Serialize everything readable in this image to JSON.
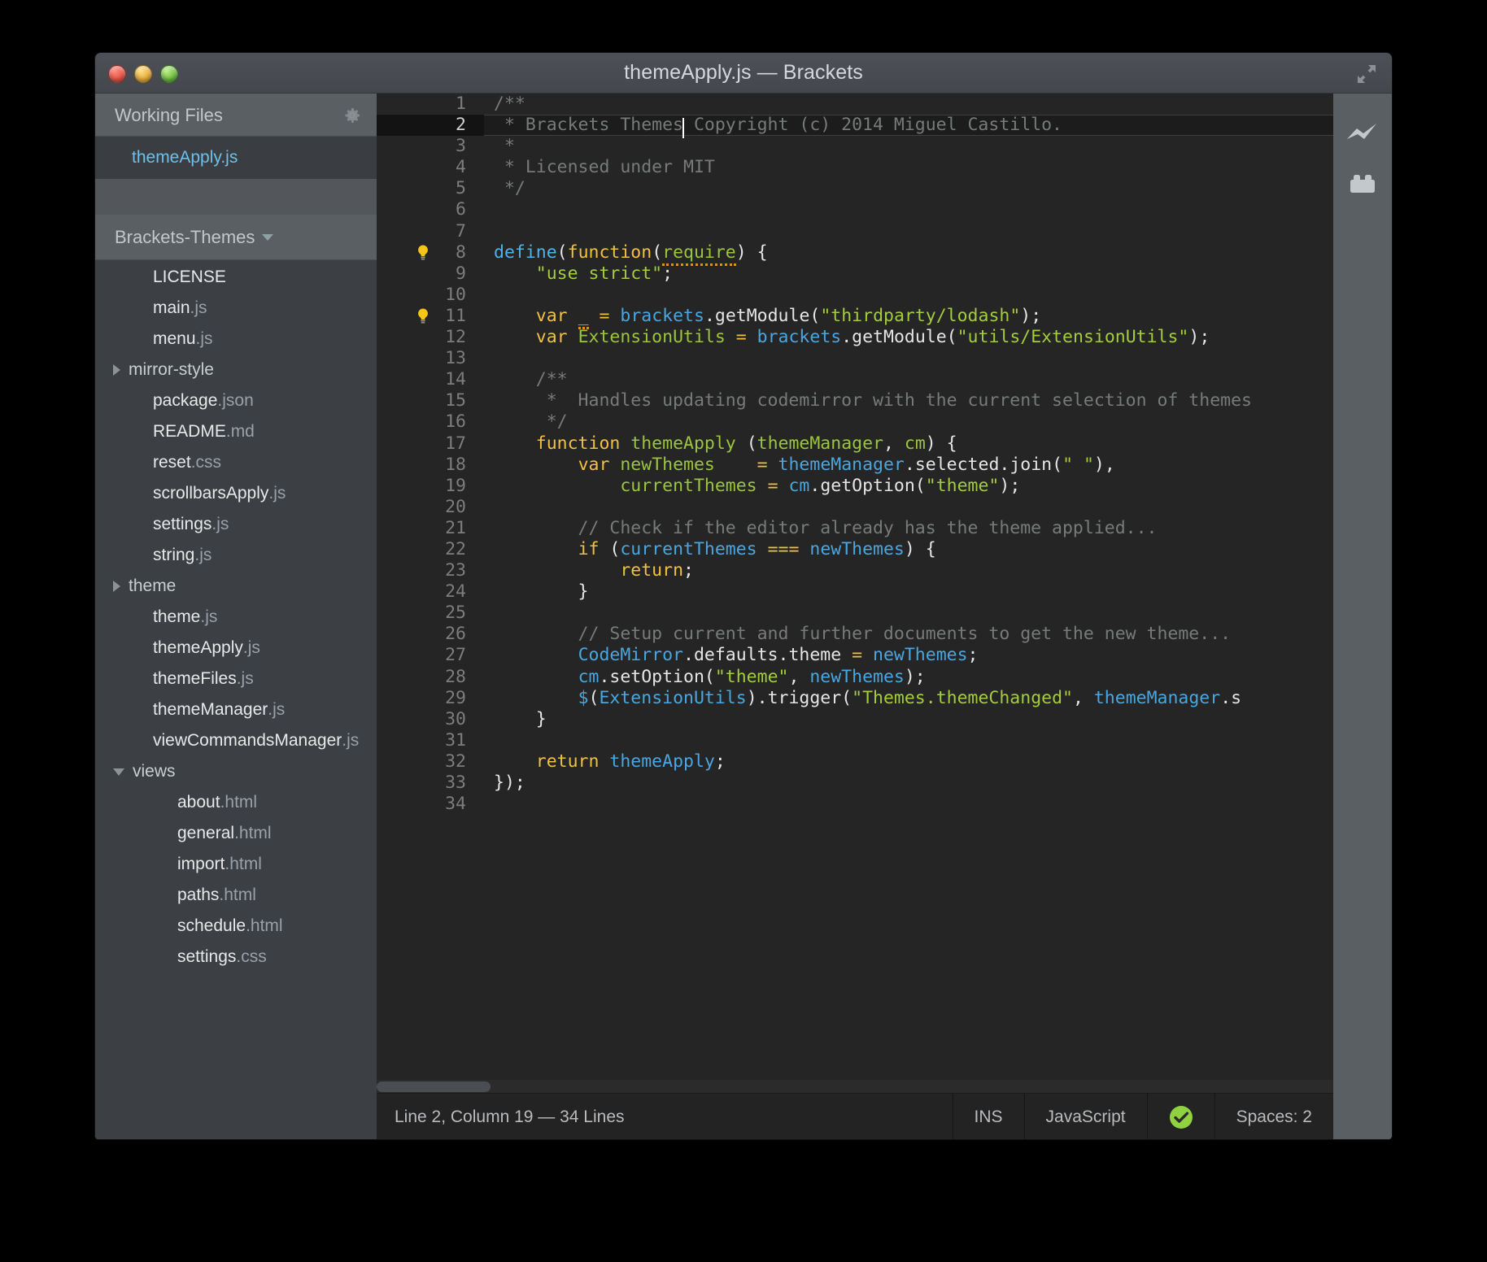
{
  "window": {
    "title": "themeApply.js — Brackets",
    "traffic_lights": [
      "close",
      "minimize",
      "zoom"
    ],
    "expand_icon": "expand-arrows-icon"
  },
  "sidebar": {
    "working_files": {
      "header_label": "Working Files",
      "gear_icon": "gear-icon",
      "items": [
        {
          "name": "themeApply",
          "ext": ".js",
          "selected": true
        }
      ]
    },
    "project": {
      "header_label": "Brackets-Themes",
      "caret_icon": "chevron-down-icon",
      "files": [
        {
          "name": "LICENSE",
          "ext": "",
          "type": "file",
          "indent": 1
        },
        {
          "name": "main",
          "ext": ".js",
          "type": "file",
          "indent": 1
        },
        {
          "name": "menu",
          "ext": ".js",
          "type": "file",
          "indent": 1
        },
        {
          "name": "mirror-style",
          "ext": "",
          "type": "folder",
          "indent": 0,
          "open": false
        },
        {
          "name": "package",
          "ext": ".json",
          "type": "file",
          "indent": 1
        },
        {
          "name": "README",
          "ext": ".md",
          "type": "file",
          "indent": 1
        },
        {
          "name": "reset",
          "ext": ".css",
          "type": "file",
          "indent": 1
        },
        {
          "name": "scrollbarsApply",
          "ext": ".js",
          "type": "file",
          "indent": 1
        },
        {
          "name": "settings",
          "ext": ".js",
          "type": "file",
          "indent": 1
        },
        {
          "name": "string",
          "ext": ".js",
          "type": "file",
          "indent": 1
        },
        {
          "name": "theme",
          "ext": "",
          "type": "folder",
          "indent": 0,
          "open": false
        },
        {
          "name": "theme",
          "ext": ".js",
          "type": "file",
          "indent": 1
        },
        {
          "name": "themeApply",
          "ext": ".js",
          "type": "file",
          "indent": 1
        },
        {
          "name": "themeFiles",
          "ext": ".js",
          "type": "file",
          "indent": 1
        },
        {
          "name": "themeManager",
          "ext": ".js",
          "type": "file",
          "indent": 1
        },
        {
          "name": "viewCommandsManager",
          "ext": ".js",
          "type": "file",
          "indent": 1
        },
        {
          "name": "views",
          "ext": "",
          "type": "folder",
          "indent": 0,
          "open": true
        },
        {
          "name": "about",
          "ext": ".html",
          "type": "file",
          "indent": 2
        },
        {
          "name": "general",
          "ext": ".html",
          "type": "file",
          "indent": 2
        },
        {
          "name": "import",
          "ext": ".html",
          "type": "file",
          "indent": 2
        },
        {
          "name": "paths",
          "ext": ".html",
          "type": "file",
          "indent": 2
        },
        {
          "name": "schedule",
          "ext": ".html",
          "type": "file",
          "indent": 2
        },
        {
          "name": "settings",
          "ext": ".css",
          "type": "file",
          "indent": 2
        }
      ]
    }
  },
  "editor": {
    "total_lines": 34,
    "active_line": 2,
    "cursor_column": 19,
    "lines": [
      {
        "n": 1,
        "bulb": false,
        "tokens": [
          {
            "t": "/**",
            "c": "c-com"
          }
        ]
      },
      {
        "n": 2,
        "bulb": false,
        "active": true,
        "tokens": [
          {
            "t": " * Brackets Themes",
            "c": "c-com"
          },
          {
            "t": "|CURSOR|",
            "c": "cursor"
          },
          {
            "t": " Copyright (c) 2014 Miguel Castillo.",
            "c": "c-com"
          }
        ]
      },
      {
        "n": 3,
        "bulb": false,
        "tokens": [
          {
            "t": " *",
            "c": "c-com"
          }
        ]
      },
      {
        "n": 4,
        "bulb": false,
        "tokens": [
          {
            "t": " * Licensed under MIT",
            "c": "c-com"
          }
        ]
      },
      {
        "n": 5,
        "bulb": false,
        "tokens": [
          {
            "t": " */",
            "c": "c-com"
          }
        ]
      },
      {
        "n": 6,
        "bulb": false,
        "tokens": []
      },
      {
        "n": 7,
        "bulb": false,
        "tokens": []
      },
      {
        "n": 8,
        "bulb": true,
        "tokens": [
          {
            "t": "define",
            "c": "c-def"
          },
          {
            "t": "(",
            "c": "c-punc"
          },
          {
            "t": "function",
            "c": "c-kw"
          },
          {
            "t": "(",
            "c": "c-punc"
          },
          {
            "t": "require",
            "c": "c-var squig"
          },
          {
            "t": ") {",
            "c": "c-punc"
          }
        ]
      },
      {
        "n": 9,
        "bulb": false,
        "tokens": [
          {
            "t": "    ",
            "c": "c-punc"
          },
          {
            "t": "\"use strict\"",
            "c": "c-str"
          },
          {
            "t": ";",
            "c": "c-punc"
          }
        ]
      },
      {
        "n": 10,
        "bulb": false,
        "tokens": []
      },
      {
        "n": 11,
        "bulb": true,
        "tokens": [
          {
            "t": "    ",
            "c": "c-punc"
          },
          {
            "t": "var",
            "c": "c-kw"
          },
          {
            "t": " ",
            "c": "c-punc"
          },
          {
            "t": "_",
            "c": "c-var squig"
          },
          {
            "t": " ",
            "c": "c-punc"
          },
          {
            "t": "=",
            "c": "c-kw"
          },
          {
            "t": " ",
            "c": "c-punc"
          },
          {
            "t": "brackets",
            "c": "c-atom"
          },
          {
            "t": ".getModule(",
            "c": "c-punc"
          },
          {
            "t": "\"thirdparty/lodash\"",
            "c": "c-str"
          },
          {
            "t": ");",
            "c": "c-punc"
          }
        ]
      },
      {
        "n": 12,
        "bulb": false,
        "tokens": [
          {
            "t": "    ",
            "c": "c-punc"
          },
          {
            "t": "var",
            "c": "c-kw"
          },
          {
            "t": " ",
            "c": "c-punc"
          },
          {
            "t": "ExtensionUtils",
            "c": "c-var"
          },
          {
            "t": " ",
            "c": "c-punc"
          },
          {
            "t": "=",
            "c": "c-kw"
          },
          {
            "t": " ",
            "c": "c-punc"
          },
          {
            "t": "brackets",
            "c": "c-atom"
          },
          {
            "t": ".getModule(",
            "c": "c-punc"
          },
          {
            "t": "\"utils/ExtensionUtils\"",
            "c": "c-str"
          },
          {
            "t": ");",
            "c": "c-punc"
          }
        ]
      },
      {
        "n": 13,
        "bulb": false,
        "tokens": []
      },
      {
        "n": 14,
        "bulb": false,
        "tokens": [
          {
            "t": "    /**",
            "c": "c-com"
          }
        ]
      },
      {
        "n": 15,
        "bulb": false,
        "tokens": [
          {
            "t": "     *  Handles updating codemirror with the current selection of themes",
            "c": "c-com"
          }
        ]
      },
      {
        "n": 16,
        "bulb": false,
        "tokens": [
          {
            "t": "     */",
            "c": "c-com"
          }
        ]
      },
      {
        "n": 17,
        "bulb": false,
        "tokens": [
          {
            "t": "    ",
            "c": "c-punc"
          },
          {
            "t": "function",
            "c": "c-kw"
          },
          {
            "t": " ",
            "c": "c-punc"
          },
          {
            "t": "themeApply",
            "c": "c-var"
          },
          {
            "t": " (",
            "c": "c-punc"
          },
          {
            "t": "themeManager",
            "c": "c-var"
          },
          {
            "t": ", ",
            "c": "c-punc"
          },
          {
            "t": "cm",
            "c": "c-var"
          },
          {
            "t": ") {",
            "c": "c-punc"
          }
        ]
      },
      {
        "n": 18,
        "bulb": false,
        "tokens": [
          {
            "t": "        ",
            "c": "c-punc"
          },
          {
            "t": "var",
            "c": "c-kw"
          },
          {
            "t": " ",
            "c": "c-punc"
          },
          {
            "t": "newThemes",
            "c": "c-var"
          },
          {
            "t": "    ",
            "c": "c-punc"
          },
          {
            "t": "=",
            "c": "c-kw"
          },
          {
            "t": " ",
            "c": "c-punc"
          },
          {
            "t": "themeManager",
            "c": "c-atom"
          },
          {
            "t": ".selected.join(",
            "c": "c-punc"
          },
          {
            "t": "\" \"",
            "c": "c-str"
          },
          {
            "t": "),",
            "c": "c-punc"
          }
        ]
      },
      {
        "n": 19,
        "bulb": false,
        "tokens": [
          {
            "t": "            ",
            "c": "c-punc"
          },
          {
            "t": "currentThemes",
            "c": "c-var"
          },
          {
            "t": " ",
            "c": "c-punc"
          },
          {
            "t": "=",
            "c": "c-kw"
          },
          {
            "t": " ",
            "c": "c-punc"
          },
          {
            "t": "cm",
            "c": "c-atom"
          },
          {
            "t": ".getOption(",
            "c": "c-punc"
          },
          {
            "t": "\"theme\"",
            "c": "c-str"
          },
          {
            "t": ");",
            "c": "c-punc"
          }
        ]
      },
      {
        "n": 20,
        "bulb": false,
        "tokens": []
      },
      {
        "n": 21,
        "bulb": false,
        "tokens": [
          {
            "t": "        // Check if the editor already has the theme applied...",
            "c": "c-com"
          }
        ]
      },
      {
        "n": 22,
        "bulb": false,
        "tokens": [
          {
            "t": "        ",
            "c": "c-punc"
          },
          {
            "t": "if",
            "c": "c-kw"
          },
          {
            "t": " (",
            "c": "c-punc"
          },
          {
            "t": "currentThemes",
            "c": "c-atom"
          },
          {
            "t": " ",
            "c": "c-punc"
          },
          {
            "t": "===",
            "c": "c-kw"
          },
          {
            "t": " ",
            "c": "c-punc"
          },
          {
            "t": "newThemes",
            "c": "c-atom"
          },
          {
            "t": ") {",
            "c": "c-punc"
          }
        ]
      },
      {
        "n": 23,
        "bulb": false,
        "tokens": [
          {
            "t": "            ",
            "c": "c-punc"
          },
          {
            "t": "return",
            "c": "c-kw"
          },
          {
            "t": ";",
            "c": "c-punc"
          }
        ]
      },
      {
        "n": 24,
        "bulb": false,
        "tokens": [
          {
            "t": "        }",
            "c": "c-punc"
          }
        ]
      },
      {
        "n": 25,
        "bulb": false,
        "tokens": []
      },
      {
        "n": 26,
        "bulb": false,
        "tokens": [
          {
            "t": "        // Setup current and further documents to get the new theme...",
            "c": "c-com"
          }
        ]
      },
      {
        "n": 27,
        "bulb": false,
        "tokens": [
          {
            "t": "        ",
            "c": "c-punc"
          },
          {
            "t": "CodeMirror",
            "c": "c-atom"
          },
          {
            "t": ".defaults.theme ",
            "c": "c-punc"
          },
          {
            "t": "=",
            "c": "c-kw"
          },
          {
            "t": " ",
            "c": "c-punc"
          },
          {
            "t": "newThemes",
            "c": "c-atom"
          },
          {
            "t": ";",
            "c": "c-punc"
          }
        ]
      },
      {
        "n": 28,
        "bulb": false,
        "tokens": [
          {
            "t": "        ",
            "c": "c-punc"
          },
          {
            "t": "cm",
            "c": "c-atom"
          },
          {
            "t": ".setOption(",
            "c": "c-punc"
          },
          {
            "t": "\"theme\"",
            "c": "c-str"
          },
          {
            "t": ", ",
            "c": "c-punc"
          },
          {
            "t": "newThemes",
            "c": "c-atom"
          },
          {
            "t": ");",
            "c": "c-punc"
          }
        ]
      },
      {
        "n": 29,
        "bulb": false,
        "tokens": [
          {
            "t": "        ",
            "c": "c-punc"
          },
          {
            "t": "$",
            "c": "c-atom"
          },
          {
            "t": "(",
            "c": "c-punc"
          },
          {
            "t": "ExtensionUtils",
            "c": "c-atom"
          },
          {
            "t": ").trigger(",
            "c": "c-punc"
          },
          {
            "t": "\"Themes.themeChanged\"",
            "c": "c-str"
          },
          {
            "t": ", ",
            "c": "c-punc"
          },
          {
            "t": "themeManager",
            "c": "c-atom"
          },
          {
            "t": ".s",
            "c": "c-punc"
          }
        ]
      },
      {
        "n": 30,
        "bulb": false,
        "tokens": [
          {
            "t": "    }",
            "c": "c-punc"
          }
        ]
      },
      {
        "n": 31,
        "bulb": false,
        "tokens": []
      },
      {
        "n": 32,
        "bulb": false,
        "tokens": [
          {
            "t": "    ",
            "c": "c-punc"
          },
          {
            "t": "return",
            "c": "c-kw"
          },
          {
            "t": " ",
            "c": "c-punc"
          },
          {
            "t": "themeApply",
            "c": "c-atom"
          },
          {
            "t": ";",
            "c": "c-punc"
          }
        ]
      },
      {
        "n": 33,
        "bulb": false,
        "tokens": [
          {
            "t": "});",
            "c": "c-punc"
          }
        ]
      },
      {
        "n": 34,
        "bulb": false,
        "tokens": []
      }
    ]
  },
  "statusbar": {
    "cursor_info": "Line 2, Column 19 — 34 Lines",
    "overwrite_mode": "INS",
    "language": "JavaScript",
    "lint_icon": "check-circle-icon",
    "indent": "Spaces:  2"
  },
  "right_rail": {
    "buttons": [
      {
        "icon": "live-preview-icon"
      },
      {
        "icon": "extension-manager-icon"
      }
    ]
  },
  "colors": {
    "accent_blue": "#6bc1ea",
    "string_green": "#a3cc3e",
    "keyword_yellow": "#f0c040",
    "lint_green": "#8fd13f",
    "window_chrome": "#4d5157",
    "sidebar_bg": "#3c4044",
    "editor_bg": "#252525"
  }
}
